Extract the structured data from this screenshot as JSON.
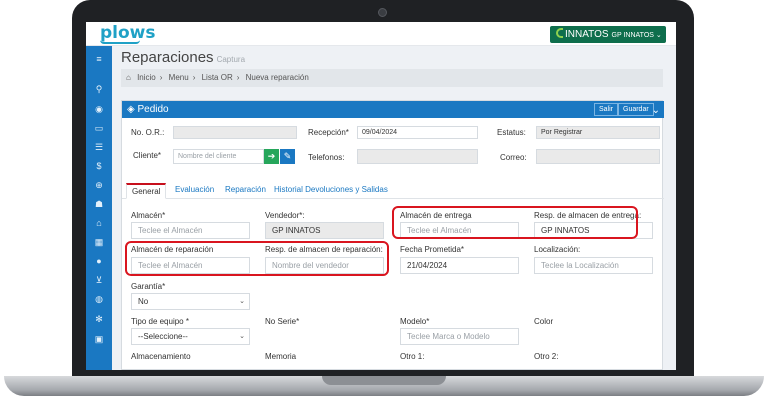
{
  "app": {
    "logo": "plows",
    "brand": "INNATOS",
    "brand_sub": "GP INNATOS ⌄"
  },
  "page": {
    "title": "Reparaciones",
    "subtitle": "Captura"
  },
  "breadcrumb": [
    "Inicio",
    "Menu",
    "Lista OR",
    "Nueva reparación"
  ],
  "sidebar_icons": [
    "hamburger-icon",
    "search-icon",
    "eye-icon",
    "folder-icon",
    "list-icon",
    "dollar-icon",
    "globe-icon",
    "group-icon",
    "bank-icon",
    "table-icon",
    "globe2-icon",
    "cart-icon",
    "globe3-icon",
    "gear-icon",
    "lock-icon"
  ],
  "card": {
    "title": "Pedido",
    "salir": "Salir",
    "guardar": "Guardar"
  },
  "header_form": {
    "no_or_label": "No. O.R.:",
    "recepcion_label": "Recepción*",
    "recepcion_value": "09/04/2024",
    "estatus_label": "Estatus:",
    "estatus_value": "Por Registrar",
    "cliente_label": "Cliente*",
    "cliente_placeholder": "Nombre del cliente",
    "telefonos_label": "Telefonos:",
    "correo_label": "Correo:"
  },
  "tabs": [
    "General",
    "Evaluación",
    "Reparación",
    "Historial Devoluciones y Salidas"
  ],
  "general": {
    "almacen_label": "Almacén*",
    "almacen_placeholder": "Teclee el Almacén",
    "vendedor_label": "Vendedor*:",
    "vendedor_value": "GP INNATOS",
    "almacen_entrega_label": "Almacén de entrega",
    "almacen_entrega_placeholder": "Teclee el Almacén",
    "resp_entrega_label": "Resp. de almacen de entrega:",
    "resp_entrega_value": "GP INNATOS",
    "almacen_reparacion_label": "Almacén de reparación",
    "almacen_reparacion_placeholder": "Teclee el Almacén",
    "resp_reparacion_label": "Resp. de almacen de reparación:",
    "resp_reparacion_placeholder": "Nombre del vendedor",
    "fecha_prometida_label": "Fecha Prometida*",
    "fecha_prometida_value": "21/04/2024",
    "localizacion_label": "Localización:",
    "localizacion_placeholder": "Teclee la Localización",
    "garantia_label": "Garantía*",
    "garantia_value": "No",
    "tipo_equipo_label": "Tipo de equipo *",
    "tipo_equipo_value": "--Seleccione--",
    "no_serie_label": "No Serie*",
    "modelo_label": "Modelo*",
    "modelo_placeholder": "Teclee Marca o Modelo",
    "color_label": "Color",
    "almacenamiento_label": "Almacenamiento",
    "memoria_label": "Memoria",
    "otro1_label": "Otro 1:",
    "otro2_label": "Otro 2:"
  }
}
